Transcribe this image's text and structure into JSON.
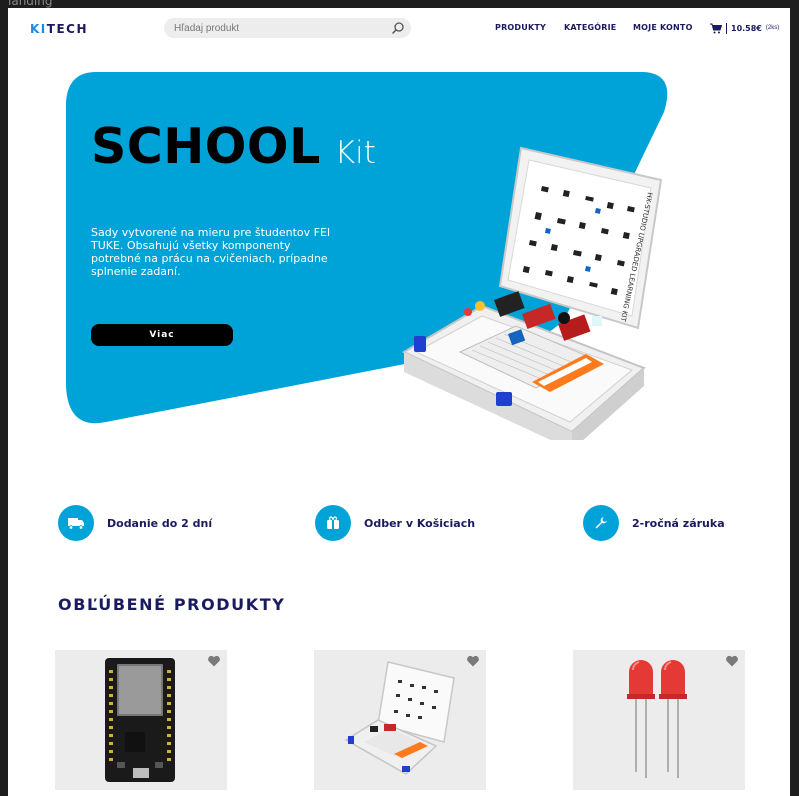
{
  "window": {
    "frame_label": "landing"
  },
  "header": {
    "logo_part1": "KI",
    "logo_part2": "TECH",
    "search_placeholder": "Hľadaj produkt",
    "nav": [
      "PRODUKTY",
      "KATEGÓRIE",
      "MOJE KONTO"
    ],
    "cart_price": "10.58€",
    "cart_count": "(2ks)"
  },
  "hero": {
    "title_bold": "SCHOOL",
    "title_light": "Kit",
    "description": "Sady vytvorené na mieru pre študentov FEI TUKE. Obsahujú všetky komponenty potrebné na prácu na cvičeniach, prípadne splnenie zadaní.",
    "button_label": "Viac",
    "kit_label": "HX-STUDIO UPGRADED LEARNING KIT"
  },
  "features": [
    {
      "label": "Dodanie do 2 dní",
      "icon": "delivery-truck-icon"
    },
    {
      "label": "Odber v Košiciach",
      "icon": "gift-box-icon"
    },
    {
      "label": "2-ročná záruka",
      "icon": "wrench-icon"
    }
  ],
  "products_section": {
    "title": "OBĽÚBENÉ PRODUKTY"
  },
  "products": [
    {
      "icon": "esp32-board-image"
    },
    {
      "icon": "learning-kit-image"
    },
    {
      "icon": "red-led-image"
    }
  ],
  "colors": {
    "accent": "#00a3d8",
    "navy": "#1a1a5e",
    "card_bg": "#ececec"
  }
}
